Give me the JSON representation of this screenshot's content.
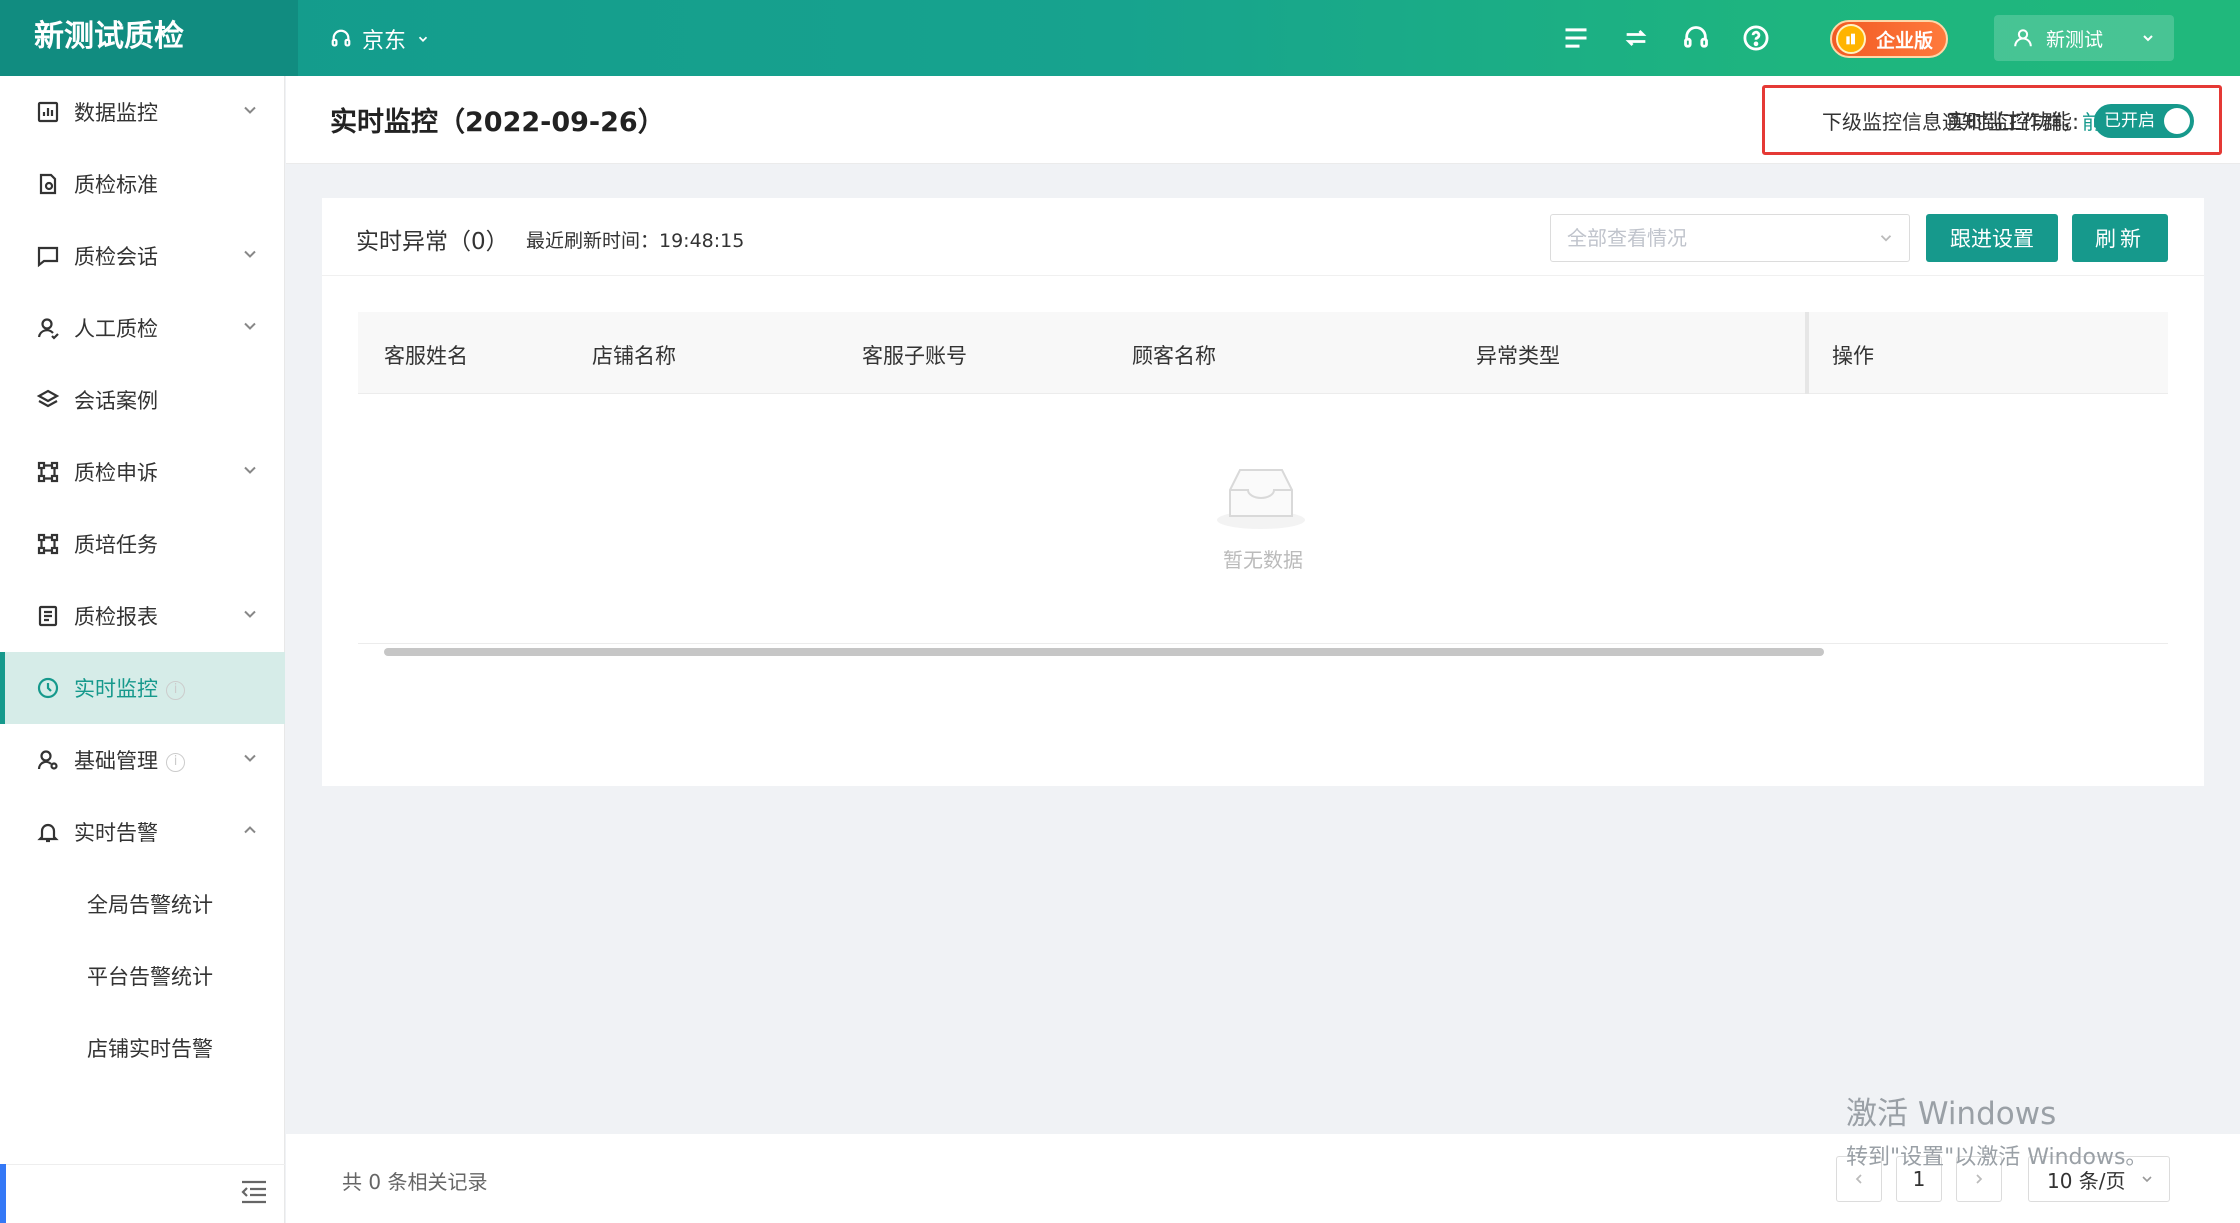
{
  "brand": "新测试质检",
  "platform": "京东",
  "enterprise_label": "企业版",
  "user_name": "新测试",
  "sidebar": {
    "items": [
      {
        "label": "数据监控"
      },
      {
        "label": "质检标准"
      },
      {
        "label": "质检会话"
      },
      {
        "label": "人工质检"
      },
      {
        "label": "会话案例"
      },
      {
        "label": "质检申诉"
      },
      {
        "label": "质培任务"
      },
      {
        "label": "质检报表"
      },
      {
        "label": "实时监控"
      },
      {
        "label": "基础管理"
      },
      {
        "label": "实时告警"
      }
    ],
    "sub_items": [
      {
        "label": "全局告警统计"
      },
      {
        "label": "平台告警统计"
      },
      {
        "label": "店铺实时告警"
      }
    ]
  },
  "header": {
    "title": "实时监控（2022-09-26）",
    "notice_text": "下级监控信息通知到工作群，",
    "notice_link": "前往设置",
    "toggle_label": "实时监控功能:",
    "toggle_state": "已开启"
  },
  "card": {
    "title": "实时异常（0）",
    "refresh_time_label": "最近刷新时间：19:48:15",
    "select_placeholder": "全部查看情况",
    "follow_button": "跟进设置",
    "refresh_button": "刷新",
    "columns": [
      "客服姓名",
      "店铺名称",
      "客服子账号",
      "顾客名称",
      "异常类型",
      "操作"
    ],
    "empty_text": "暂无数据"
  },
  "footer": {
    "total": "共 0 条相关记录",
    "current_page": "1",
    "page_size": "10 条/页"
  },
  "watermark": {
    "line1": "激活 Windows",
    "line2": "转到\"设置\"以激活 Windows。"
  },
  "colors": {
    "accent": "#16998c",
    "alert_border": "#e53935",
    "enterprise": "#f15a24"
  }
}
